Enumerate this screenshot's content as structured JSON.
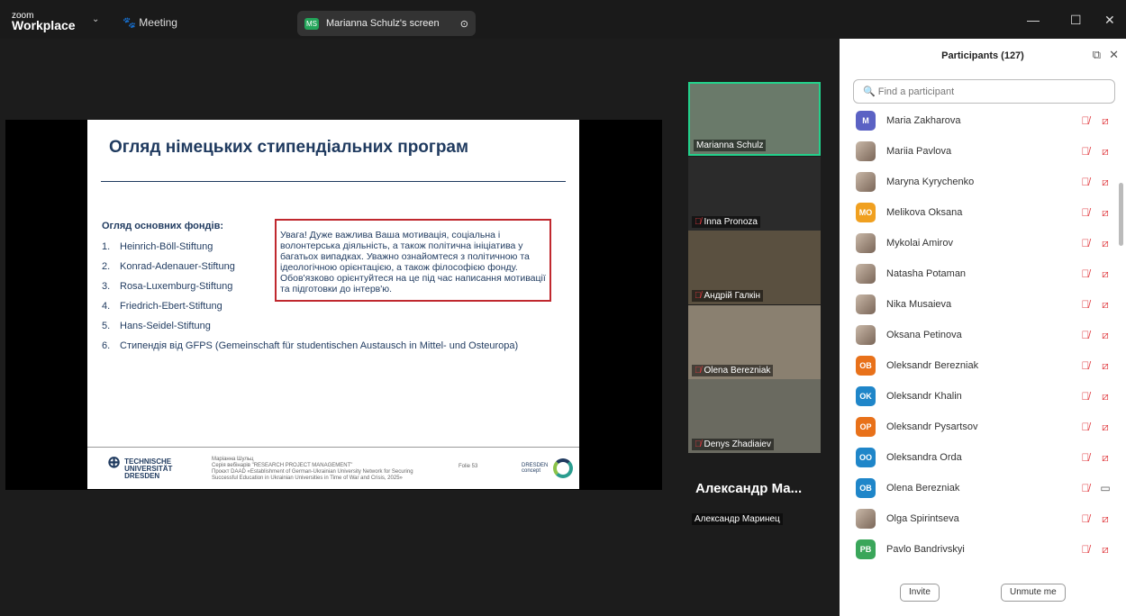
{
  "topbar": {
    "logo_small": "zoom",
    "logo_big": "Workplace",
    "meeting": "Meeting",
    "share_initials": "MS",
    "share_label": "Marianna Schulz's screen"
  },
  "slide": {
    "title": "Огляд німецьких стипендіальних програм",
    "subtitle": "Огляд основних фондів:",
    "items": [
      {
        "n": "1.",
        "t": "Heinrich-Böll-Stiftung"
      },
      {
        "n": "2.",
        "t": "Konrad-Adenauer-Stiftung"
      },
      {
        "n": "3.",
        "t": "Rosa-Luxemburg-Stiftung"
      },
      {
        "n": "4.",
        "t": "Friedrich-Ebert-Stiftung"
      },
      {
        "n": "5.",
        "t": "Hans-Seidel-Stiftung"
      },
      {
        "n": "6.",
        "t": "Стипендія від GFPS (Gemeinschaft für studentischen Austausch in Mittel- und Osteuropa)"
      }
    ],
    "note": "Увага! Дуже важлива Ваша мотивація, соціальна і волонтерська діяльність, а також політична ініціатива у багатьох випадках. Уважно ознайомтеся з політичною та ідеологічною орієнтацією, а також філософією фонду. Обов'язково орієнтуйтеся на це під час написання мотивації та підготовки до інтерв'ю.",
    "footer": {
      "logo1": "TECHNISCHE",
      "logo2": "UNIVERSITÄT",
      "logo3": "DRESDEN",
      "l1": "Маріанна Шульц",
      "l2": "Серія вебінарів \"RESEARCH PROJECT MANAGEMENT\"",
      "l3": "Проєкт DAAD «Establishment of German-Ukrainian University Network for Securing",
      "l4": "Successful Education in Ukrainian Universities in Time of War and Crisis, 2025»",
      "folie": "Folie 53",
      "dresden": "DRESDEN",
      "concept": "concept"
    }
  },
  "tiles": [
    {
      "name": "Marianna Schulz",
      "muted": false
    },
    {
      "name": "Inna Pronoza",
      "muted": true
    },
    {
      "name": "Андрій Галкін",
      "muted": true
    },
    {
      "name": "Olena Berezniak",
      "muted": true
    },
    {
      "name": "Denys Zhadiaiev",
      "muted": true
    },
    {
      "name": "Александр Маринец",
      "big": "Александр  Ма...",
      "muted": false
    }
  ],
  "panel": {
    "title": "Participants (127)",
    "search_placeholder": "Find a participant",
    "invite": "Invite",
    "unmute": "Unmute me",
    "participants": [
      {
        "name": "Maria Zakharova",
        "initials": "M",
        "color": "#5b62c4",
        "video": false
      },
      {
        "name": "Mariia Pavlova",
        "initials": "",
        "video": false
      },
      {
        "name": "Maryna Kyrychenko",
        "initials": "",
        "video": false
      },
      {
        "name": "Melikova Oksana",
        "initials": "MO",
        "color": "#f0a020",
        "video": false
      },
      {
        "name": "Mykolai Amirov",
        "initials": "",
        "video": false
      },
      {
        "name": "Natasha Potaman",
        "initials": "",
        "video": false
      },
      {
        "name": "Nika Musaieva",
        "initials": "",
        "video": false
      },
      {
        "name": "Oksana Petinova",
        "initials": "",
        "video": false
      },
      {
        "name": "Oleksandr Berezniak",
        "initials": "OB",
        "color": "#e8711a",
        "video": false
      },
      {
        "name": "Oleksandr Khalin",
        "initials": "OK",
        "color": "#1f86c9",
        "video": false
      },
      {
        "name": "Oleksandr Pysartsov",
        "initials": "OP",
        "color": "#e8711a",
        "video": false
      },
      {
        "name": "Oleksandra Orda",
        "initials": "OO",
        "color": "#1f86c9",
        "video": false
      },
      {
        "name": "Olena Berezniak",
        "initials": "OB",
        "color": "#1f86c9",
        "video": true
      },
      {
        "name": "Olga Spirintseva",
        "initials": "",
        "video": false
      },
      {
        "name": "Pavlo Bandrivskyi",
        "initials": "PB",
        "color": "#3aa65a",
        "video": false
      }
    ]
  }
}
